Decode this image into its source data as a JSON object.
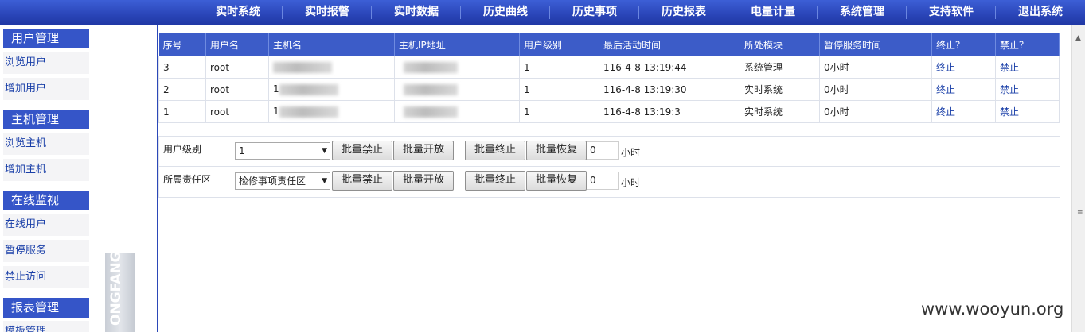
{
  "topnav": {
    "items": [
      "实时系统",
      "实时报警",
      "实时数据",
      "历史曲线",
      "历史事项",
      "历史报表",
      "电量计量",
      "系统管理",
      "支持软件",
      "退出系统"
    ]
  },
  "sidebar": {
    "sections": [
      {
        "title": "用户管理",
        "items": [
          "浏览用户",
          "增加用户"
        ]
      },
      {
        "title": "主机管理",
        "items": [
          "浏览主机",
          "增加主机"
        ]
      },
      {
        "title": "在线监视",
        "items": [
          "在线用户",
          "暂停服务",
          "禁止访问"
        ]
      },
      {
        "title": "报表管理",
        "items": [
          "模板管理"
        ]
      }
    ],
    "watermark": "ONGFANG"
  },
  "table": {
    "headers": [
      "序号",
      "用户名",
      "主机名",
      "主机IP地址",
      "用户级别",
      "最后活动时间",
      "所处模块",
      "暂停服务时间",
      "终止？",
      "禁止？"
    ],
    "rows": [
      {
        "id": "3",
        "user": "root",
        "host": "",
        "ip": "",
        "level": "1",
        "time": "116-4-8 13:19:44",
        "module": "系统管理",
        "pause": "0小时",
        "stop": "终止",
        "ban": "禁止"
      },
      {
        "id": "2",
        "user": "root",
        "host": "1",
        "ip": "",
        "level": "1",
        "time": "116-4-8 13:19:30",
        "module": "实时系统",
        "pause": "0小时",
        "stop": "终止",
        "ban": "禁止"
      },
      {
        "id": "1",
        "user": "root",
        "host": "1",
        "ip": "",
        "level": "1",
        "time": "116-4-8 13:19:3",
        "module": "实时系统",
        "pause": "0小时",
        "stop": "终止",
        "ban": "禁止"
      }
    ]
  },
  "controls": [
    {
      "label": "用户级别",
      "select": "1",
      "buttons": [
        "批量禁止",
        "批量开放",
        "批量终止",
        "批量恢复"
      ],
      "value": "0",
      "unit": "小时"
    },
    {
      "label": "所属责任区",
      "select": "检修事项责任区",
      "buttons": [
        "批量禁止",
        "批量开放",
        "批量终止",
        "批量恢复"
      ],
      "value": "0",
      "unit": "小时"
    }
  ],
  "watermark_site": "www.wooyun.org",
  "colors": {
    "nav": "#2a45b8",
    "header": "#3c5cc8",
    "link": "#1a3fa8"
  }
}
